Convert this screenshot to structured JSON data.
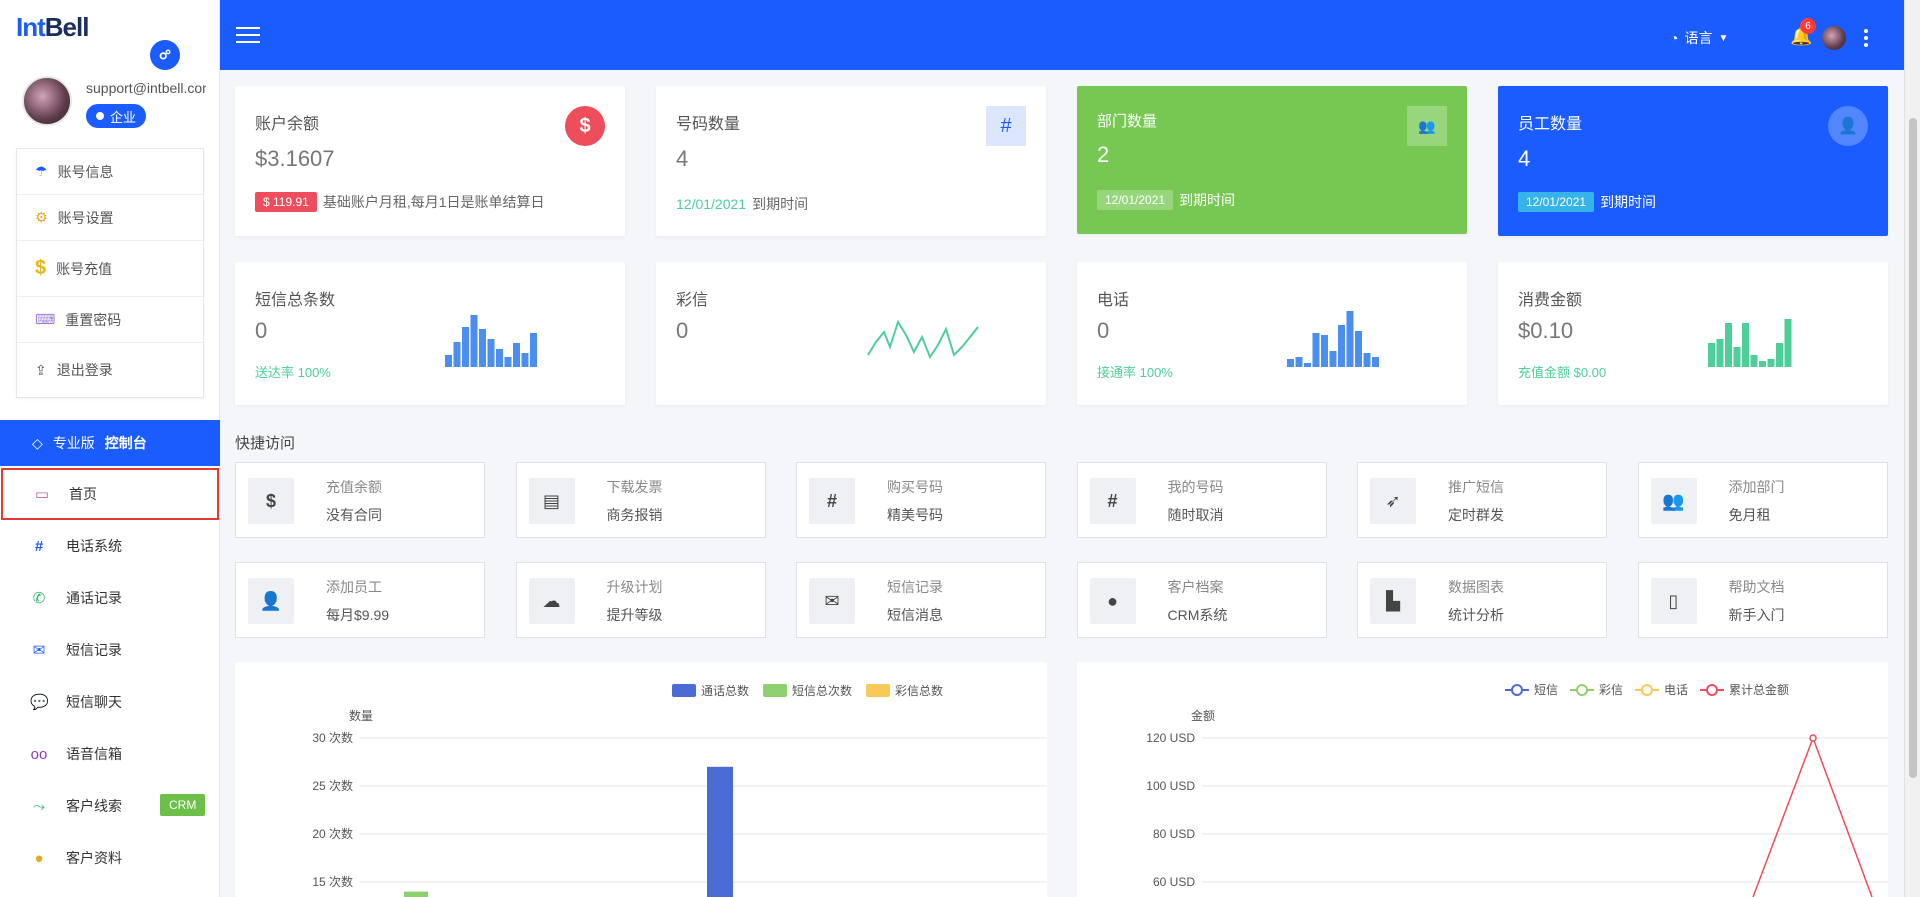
{
  "sidebar": {
    "logo_int": "Int",
    "logo_bell": "Bell",
    "profile": {
      "email": "support@intbell.com",
      "badge": "企业"
    },
    "account_menu": [
      {
        "label": "账号信息",
        "icon": "umbrella-icon"
      },
      {
        "label": "账号设置",
        "icon": "gears-icon"
      },
      {
        "label": "账号充值",
        "icon": "dollar-icon"
      },
      {
        "label": "重置密码",
        "icon": "keyboard-icon"
      },
      {
        "label": "退出登录",
        "icon": "logout-icon"
      }
    ],
    "pro_header": {
      "prefix": "专业版",
      "bold": "控制台"
    },
    "nav": [
      {
        "label": "首页",
        "icon": "monitor-icon",
        "active": true
      },
      {
        "label": "电话系统",
        "icon": "hash-icon"
      },
      {
        "label": "通话记录",
        "icon": "phone-icon"
      },
      {
        "label": "短信记录",
        "icon": "envelope-icon"
      },
      {
        "label": "短信聊天",
        "icon": "chat-icon"
      },
      {
        "label": "语音信箱",
        "icon": "voicemail-icon"
      },
      {
        "label": "客户线索",
        "icon": "route-icon",
        "badge": "CRM"
      },
      {
        "label": "客户资料",
        "icon": "user-circle-icon"
      }
    ]
  },
  "header": {
    "language": "语言",
    "notification_count": "6"
  },
  "cards": {
    "balance": {
      "title": "账户余额",
      "value": "$3.1607",
      "tag": "$ 119.91",
      "note": "基础账户月租,每月1日是账单结算日"
    },
    "numbers": {
      "title": "号码数量",
      "value": "4",
      "date": "12/01/2021",
      "note": "到期时间"
    },
    "departments": {
      "title": "部门数量",
      "value": "2",
      "date": "12/01/2021",
      "note": "到期时间"
    },
    "employees": {
      "title": "员工数量",
      "value": "4",
      "date": "12/01/2021",
      "note": "到期时间"
    }
  },
  "stats": {
    "sms": {
      "title": "短信总条数",
      "value": "0",
      "note": "送达率 100%"
    },
    "mms": {
      "title": "彩信",
      "value": "0"
    },
    "phone": {
      "title": "电话",
      "value": "0",
      "note": "接通率 100%"
    },
    "spend": {
      "title": "消费金额",
      "value": "$0.10",
      "note": "充值金额 $0.00"
    }
  },
  "quick_access": {
    "title": "快捷访问",
    "items": [
      {
        "l1": "充值余额",
        "l2": "没有合同",
        "icon": "dollar-icon"
      },
      {
        "l1": "下载发票",
        "l2": "商务报销",
        "icon": "invoice-icon"
      },
      {
        "l1": "购买号码",
        "l2": "精美号码",
        "icon": "hash-icon"
      },
      {
        "l1": "我的号码",
        "l2": "随时取消",
        "icon": "hash-icon"
      },
      {
        "l1": "推广短信",
        "l2": "定时群发",
        "icon": "paper-plane-icon"
      },
      {
        "l1": "添加部门",
        "l2": "免月租",
        "icon": "users-icon"
      },
      {
        "l1": "添加员工",
        "l2": "每月$9.99",
        "icon": "user-icon"
      },
      {
        "l1": "升级计划",
        "l2": "提升等级",
        "icon": "cloud-icon"
      },
      {
        "l1": "短信记录",
        "l2": "短信消息",
        "icon": "envelope-icon"
      },
      {
        "l1": "客户档案",
        "l2": "CRM系统",
        "icon": "user-circle-icon"
      },
      {
        "l1": "数据图表",
        "l2": "统计分析",
        "icon": "bar-chart-icon"
      },
      {
        "l1": "帮助文档",
        "l2": "新手入门",
        "icon": "document-icon"
      }
    ]
  },
  "colors": {
    "primary": "#1a5cff",
    "green": "#76c852",
    "red": "#ee4d5b",
    "teal": "#4ecf9a",
    "chart_blue": "#4b6bd6",
    "chart_green": "#8ed06e",
    "chart_yellow": "#f7c957"
  },
  "chart_data": [
    {
      "type": "bar",
      "legend": [
        "通话总数",
        "短信总次数",
        "彩信总数"
      ],
      "ylabel": "数量",
      "yticks": [
        "30 次数",
        "25 次数",
        "20 次数",
        "15 次数"
      ],
      "ylim": [
        15,
        30
      ],
      "series": [
        {
          "name": "通话总数",
          "points": [
            {
              "x_index": 5,
              "value": 27
            }
          ]
        },
        {
          "name": "短信总次数",
          "points": [
            {
              "x_index": 1,
              "value": 14
            }
          ]
        },
        {
          "name": "彩信总数",
          "points": []
        }
      ]
    },
    {
      "type": "line",
      "legend": [
        "短信",
        "彩信",
        "电话",
        "累计总金额"
      ],
      "ylabel": "金额",
      "yticks": [
        "120 USD",
        "100 USD",
        "80 USD",
        "60 USD"
      ],
      "ylim": [
        60,
        120
      ],
      "series": [
        {
          "name": "累计总金额",
          "peak": 120
        }
      ]
    }
  ]
}
